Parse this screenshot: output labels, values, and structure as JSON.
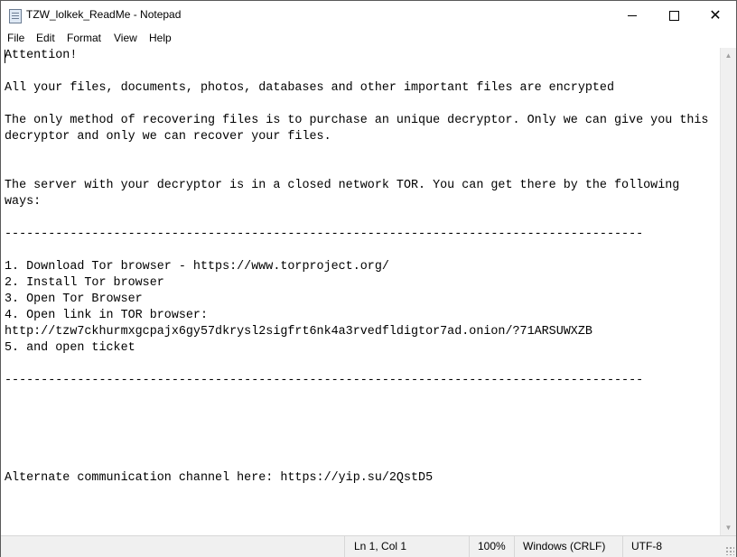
{
  "window": {
    "title": "TZW_lolkek_ReadMe - Notepad",
    "icon": "notepad-icon",
    "controls": {
      "minimize": "minimize-icon",
      "maximize": "maximize-icon",
      "close": "✕"
    }
  },
  "menu": {
    "items": [
      "File",
      "Edit",
      "Format",
      "View",
      "Help"
    ]
  },
  "editor": {
    "content": "Attention!\n\nAll your files, documents, photos, databases and other important files are encrypted\n\nThe only method of recovering files is to purchase an unique decryptor. Only we can give you this\ndecryptor and only we can recover your files.\n\n\nThe server with your decryptor is in a closed network TOR. You can get there by the following\nways:\n\n----------------------------------------------------------------------------------------\n\n1. Download Tor browser - https://www.torproject.org/\n2. Install Tor browser\n3. Open Tor Browser\n4. Open link in TOR browser:\nhttp://tzw7ckhurmxgcpajx6gy57dkrysl2sigfrt6nk4a3rvedfldigtor7ad.onion/?71ARSUWXZB\n5. and open ticket\n\n----------------------------------------------------------------------------------------\n\n\n\n\n\nAlternate communication channel here: https://yip.su/2QstD5"
  },
  "statusbar": {
    "position": "Ln 1, Col 1",
    "zoom": "100%",
    "line_ending": "Windows (CRLF)",
    "encoding": "UTF-8"
  },
  "scrollbar": {
    "up": "▲",
    "down": "▼"
  }
}
